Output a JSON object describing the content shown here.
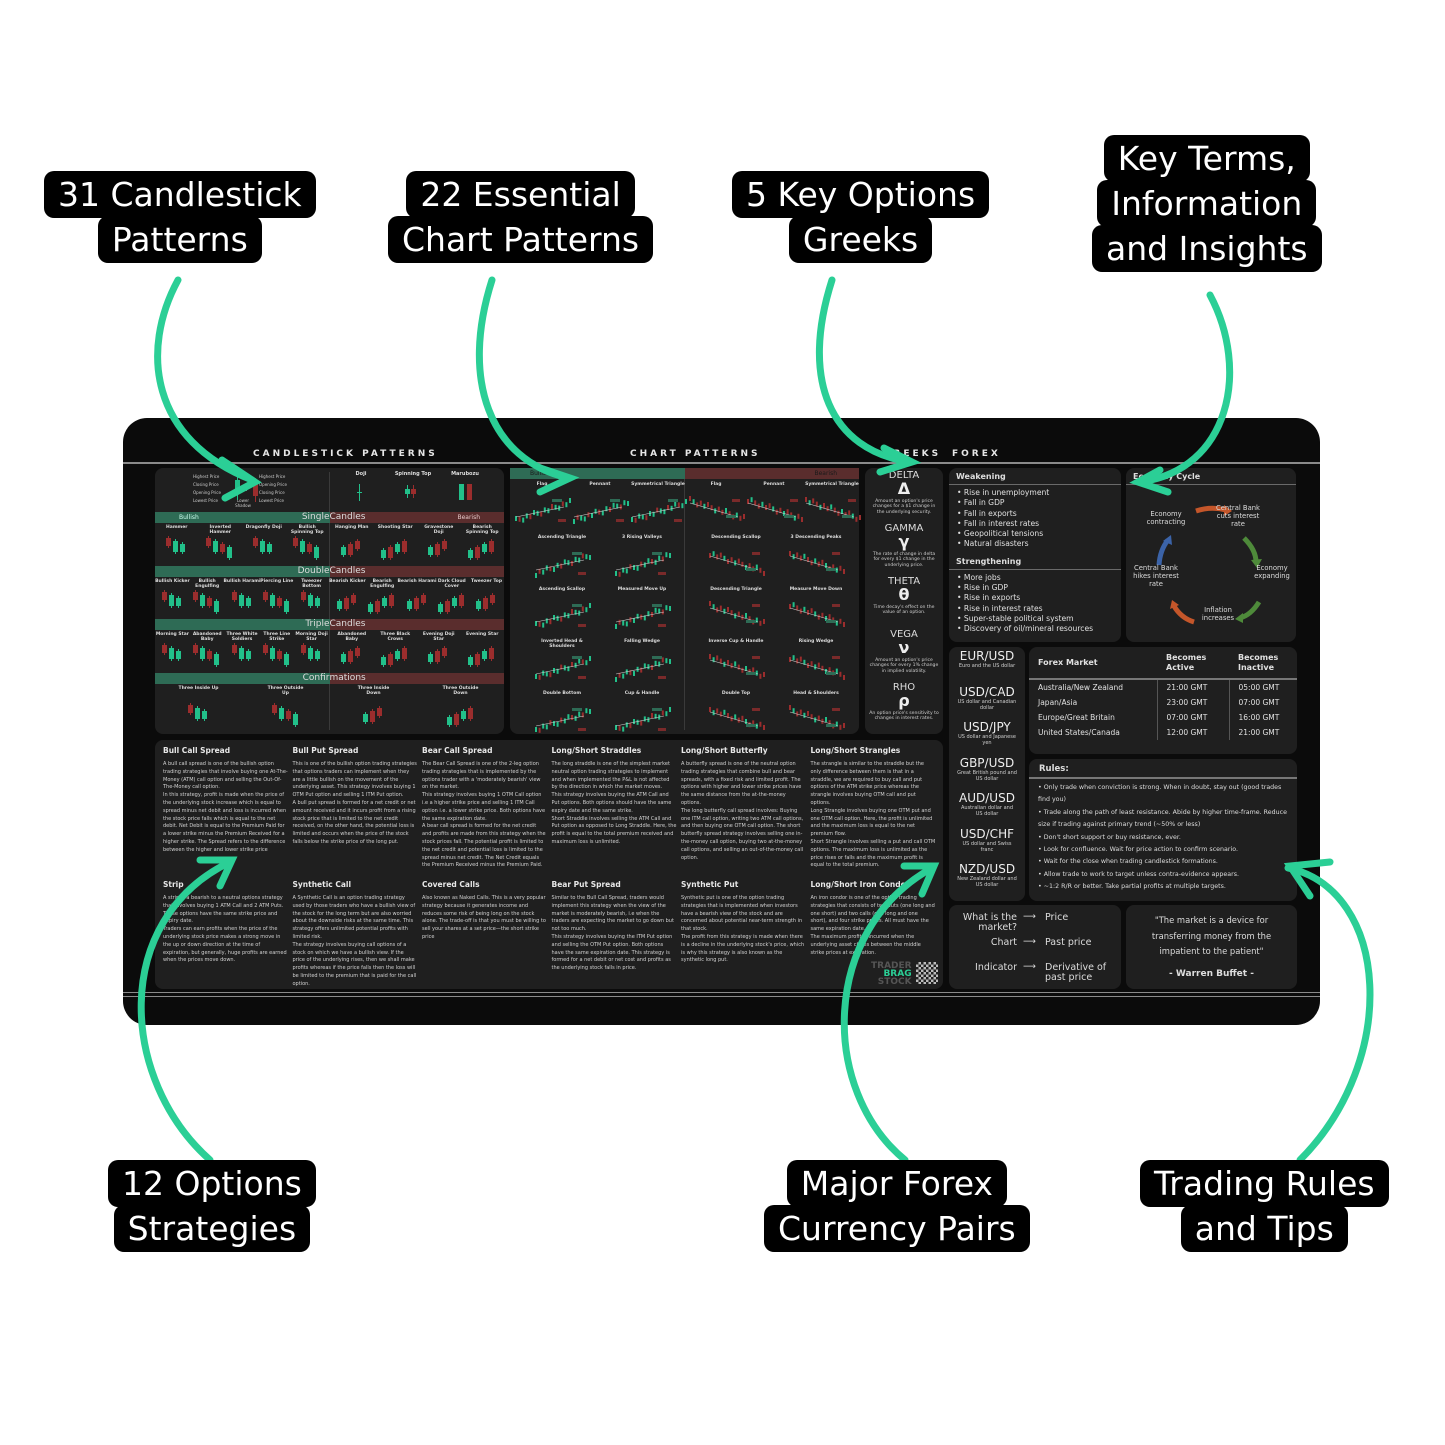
{
  "callouts": [
    {
      "id": "candlestick",
      "lines": [
        "31  Candlestick",
        "Patterns"
      ]
    },
    {
      "id": "chart",
      "lines": [
        "22 Essential",
        "Chart Patterns"
      ]
    },
    {
      "id": "greeks",
      "lines": [
        "5 Key Options",
        "Greeks"
      ]
    },
    {
      "id": "terms",
      "lines": [
        "Key Terms,",
        "Information",
        "and Insights"
      ]
    },
    {
      "id": "options",
      "lines": [
        "12 Options",
        "Strategies"
      ]
    },
    {
      "id": "forex",
      "lines": [
        "Major Forex",
        "Currency Pairs"
      ]
    },
    {
      "id": "rules",
      "lines": [
        "Trading Rules",
        "and Tips"
      ]
    }
  ],
  "colors": {
    "accent": "#2bcf96",
    "bull": "#2e6b55",
    "bear": "#5a2d2d",
    "candle_up": "#22c08a",
    "candle_down": "#9b2d2d",
    "mat": "#0b0b0b",
    "panel": "#1f1f1f"
  },
  "headers": {
    "candlestick": "CANDLESTICK PATTERNS",
    "chart": "CHART PATTERNS",
    "greeks": "GREEKS",
    "forex": "FOREX"
  },
  "candle_anatomy": {
    "labels_left": [
      "Highest Price",
      "Closing Price",
      "Opening Price",
      "Lowest Price"
    ],
    "labels_mid": [
      "Body",
      "Lower Shadow"
    ],
    "labels_right": [
      "Highest Price",
      "Opening Price",
      "Closing Price",
      "Lowest Price"
    ],
    "basic": [
      "Doji",
      "Spinning Top",
      "Marubozu"
    ]
  },
  "candlestick": {
    "side_bull": "Bullish",
    "side_bear": "Bearish",
    "sections": [
      {
        "title_a": "Single",
        "title_b": "Candles",
        "bull": [
          "Hammer",
          "Inverted Hammer",
          "Dragonfly Doji",
          "Bullish Spinning Top"
        ],
        "bear": [
          "Hanging Man",
          "Shooting Star",
          "Gravestone Doji",
          "Bearish Spinning Top"
        ]
      },
      {
        "title_a": "Double",
        "title_b": "Candles",
        "bull": [
          "Bullish Kicker",
          "Bullish Engulfing",
          "Bullish Harami",
          "Piercing Line",
          "Tweezer Bottom"
        ],
        "bear": [
          "Bearish Kicker",
          "Bearish Engulfing",
          "Bearish Harami",
          "Dark Cloud Cover",
          "Tweezer Top"
        ]
      },
      {
        "title_a": "Triple",
        "title_b": "Candles",
        "bull": [
          "Morning Star",
          "Abandoned Baby",
          "Three White Soldiers",
          "Three Line Strike",
          "Morning Doji Star"
        ],
        "bear": [
          "Abandoned Baby",
          "Three Black Crows",
          "Evening Doji Star",
          "Evening Star"
        ]
      },
      {
        "title_a": "Confir",
        "title_b": "mations",
        "bull": [
          "Three Inside Up",
          "Three Outside Up"
        ],
        "bear": [
          "Three Inside Down",
          "Three Outside Down"
        ]
      }
    ]
  },
  "chart_patterns": {
    "side_bull": "Bullish",
    "side_bear": "Bearish",
    "bull": [
      "Flag",
      "Pennant",
      "Symmetrical Triangle",
      "Ascending Triangle",
      "3 Rising Valleys",
      "Ascending Scallop",
      "Measured Move Up",
      "Inverted Head & Shoulders",
      "Falling Wedge",
      "Double Bottom",
      "Cup & Handle"
    ],
    "bear": [
      "Flag",
      "Pennant",
      "Symmetrical Triangle",
      "Descending Scallop",
      "3 Descending Peaks",
      "Descending Triangle",
      "Measure Move Down",
      "Inverse Cup & Handle",
      "Rising Wedge",
      "Double Top",
      "Head & Shoulders"
    ],
    "marker_entry": "ENTRY",
    "marker_stop": "STOP"
  },
  "greeks": [
    {
      "name": "DELTA",
      "symbol": "Δ",
      "desc": "Amount an option's price changes for a $1 change in the underlying security."
    },
    {
      "name": "GAMMA",
      "symbol": "γ",
      "desc": "The rate of change in delta for every $1 change in the underlying price."
    },
    {
      "name": "THETA",
      "symbol": "θ",
      "desc": "Time decay's effect on the value of an option."
    },
    {
      "name": "VEGA",
      "symbol": "ν",
      "desc": "Amount an option's price changes for every 1% change in implied volatility."
    },
    {
      "name": "RHO",
      "symbol": "ρ",
      "desc": "An option price's sensitivity to changes in interest rates."
    }
  ],
  "forex": {
    "weakening": {
      "title": "Weakening",
      "items": [
        "Rise in unemployment",
        "Fall in GDP",
        "Fall in exports",
        "Fall in interest rates",
        "Geopolitical tensions",
        "Natural disasters"
      ]
    },
    "strengthening": {
      "title": "Strengthening",
      "items": [
        "More jobs",
        "Rise in GDP",
        "Rise in exports",
        "Rise in interest rates",
        "Super-stable political system",
        "Discovery of oil/mineral resources"
      ]
    },
    "economy_cycle": {
      "title": "Economy Cycle",
      "steps": [
        "Economy contracting",
        "Central Bank cuts interest rate",
        "Economy expanding",
        "Inflation increases",
        "Central Bank hikes interest rate"
      ]
    },
    "pairs": [
      {
        "code": "EUR/USD",
        "desc": "Euro and the US dollar"
      },
      {
        "code": "USD/CAD",
        "desc": "US dollar and Canadian dollar"
      },
      {
        "code": "USD/JPY",
        "desc": "US dollar and Japanese yen"
      },
      {
        "code": "GBP/USD",
        "desc": "Great British pound and US dollar"
      },
      {
        "code": "AUD/USD",
        "desc": "Australian dollar and US dollar"
      },
      {
        "code": "USD/CHF",
        "desc": "US dollar and Swiss franc"
      },
      {
        "code": "NZD/USD",
        "desc": "New Zealand dollar and US dollar"
      }
    ],
    "market_table": {
      "headers": [
        "Forex Market",
        "Becomes Active",
        "Becomes Inactive"
      ],
      "rows": [
        [
          "Australia/New Zealand",
          "21:00 GMT",
          "05:00 GMT"
        ],
        [
          "Japan/Asia",
          "23:00 GMT",
          "07:00 GMT"
        ],
        [
          "Europe/Great Britain",
          "07:00 GMT",
          "16:00 GMT"
        ],
        [
          "United States/Canada",
          "12:00 GMT",
          "21:00 GMT"
        ]
      ]
    },
    "rules": {
      "title": "Rules:",
      "items": [
        "Only trade when conviction is strong. When in doubt, stay out (good trades find you)",
        "Trade along the path of least resistance. Abide by higher time-frame. Reduce size if trading against primary trend (~50% or less)",
        "Don't short support or buy resistance, ever.",
        "Look for confluence. Wait for price action to confirm scenario.",
        "Wait for the close when trading candlestick formations.",
        "Allow trade to work to target unless contra-evidence appears.",
        "~1:2 R/R or better. Take partial profits at multiple targets."
      ]
    },
    "terms": [
      {
        "term": "What is the market?",
        "meaning": "Price"
      },
      {
        "term": "Chart",
        "meaning": "Past price"
      },
      {
        "term": "Indicator",
        "meaning": "Derivative of past price"
      }
    ],
    "quote": {
      "text": "\"The market is a device for transferring money from the impatient to the patient\"",
      "author": "- Warren Buffet -"
    }
  },
  "strategies": [
    {
      "title": "Bull Call Spread",
      "body": "A bull call spread is one of the bullish option trading strategies that involve buying one At-The-Money (ATM) call option and selling the Out-Of-The-Money call option.\nIn this strategy, profit is made when the price of the underlying stock increase which is equal to spread minus net debit and loss is incurred when the stock price falls which is equal to the net debit. Net Debit is equal to the Premium Paid for a lower strike minus the Premium Received for a higher strike. The Spread refers to the difference between the higher and lower strike price"
    },
    {
      "title": "Bull Put Spread",
      "body": "This is one of the bullish option trading strategies that options traders can implement when they are a little bullish on the movement of the underlying asset. This strategy involves buying 1 OTM Put option and selling 1 ITM Put option.\nA bull put spread is formed for a net credit or net amount received and it incurs profit from a rising stock price that is limited to the net credit received, on the other hand, the potential loss is limited and occurs when the price of the stock falls below the strike price of the long put."
    },
    {
      "title": "Bear Call Spread",
      "body": "The Bear Call Spread is one of the 2-leg option trading strategies that is implemented by the options trader with a 'moderately bearish' view on the market.\nThis strategy involves buying 1 OTM Call option i.e a higher strike price and selling 1 ITM Call option i.e. a lower strike price. Both options have the same expiration date.\nA bear call spread is formed for the net credit and profits are made from this strategy when the stock prices fall. The potential profit is limited to the net credit and potential loss is limited to the spread minus net credit. The Net Credit equals the Premium Received minus the Premium Paid."
    },
    {
      "title": "Long/Short Straddles",
      "body": "The long straddle is one of the simplest market neutral option trading strategies to implement and when implemented the P&L is not affected by the direction in which the market moves.\nThis strategy involves buying the ATM Call and Put options. Both options should have the same expiry date and the same strike.\nShort Straddle involves selling the ATM Call and Put option as opposed to Long Straddle. Here, the profit is equal to the total premium received and maximum loss is unlimited."
    },
    {
      "title": "Long/Short Butterfly",
      "body": "A butterfly spread is one of the neutral option trading strategies that combine bull and bear spreads, with a fixed risk and limited profit. The options with higher and lower strike prices have the same distance from the at-the-money options.\nThe long butterfly call spread involves: Buying one ITM call option, writing two ATM call options, and then buying one OTM call option. The short butterfly spread strategy involves selling one in-the-money call option, buying two at-the-money call options, and selling an out-of-the-money call option."
    },
    {
      "title": "Long/Short Strangles",
      "body": "The strangle is similar to the straddle but the only difference between them is that in a straddle, we are required to buy call and put options of the ATM strike price whereas the strangle involves buying OTM call and put options.\nLong Strangle involves buying one OTM put and one OTM call option. Here, the profit is unlimited and the maximum loss is equal to the net premium flow.\nShort Strangle involves selling a put and call OTM options. The maximum loss is unlimited as the price rises or falls and the maximum profit is equal to the total premium."
    },
    {
      "title": "Strip",
      "body": "A strip is a bearish to a neutral options strategy that involves buying 1 ATM Call and 2 ATM Puts.\nThese options have the same strike price and expiry date.\nTraders can earn profits when the price of the underlying stock price makes a strong move in the up or down direction at the time of expiration, but generally, huge profits are earned when the prices move down."
    },
    {
      "title": "Synthetic Call",
      "body": "A Synthetic Call is an option trading strategy used by those traders who have a bullish view of the stock for the long term but are also worried about the downside risks at the same time. This strategy offers unlimited potential profits with limited risk.\nThe strategy involves buying call options of a stock on which we have a bullish view. If the price of the underlying rises, then we shall make profits whereas if the price falls then the loss will be limited to the premium that is paid for the call option."
    },
    {
      "title": "Covered Calls",
      "body": "Also known as Naked Calls. This is a very popular strategy because it generates income and reduces some risk of being long on the stock alone. The trade-off is that you must be willing to sell your shares at a set price—the short strike price"
    },
    {
      "title": "Bear Put Spread",
      "body": "Similar to the Bull Call Spread, traders would implement this strategy when the view of the market is moderately bearish, i.e when the traders are expecting the market to go down but not too much.\nThis strategy involves buying the ITM Put option and selling the OTM Put option. Both options have the same expiration date. This strategy is formed for a net debit or net cost and profits as the underlying stock falls in price."
    },
    {
      "title": "Synthetic Put",
      "body": "Synthetic put is one of the option trading strategies that is implemented when investors have a bearish view of the stock and are concerned about potential near-term strength in that stock.\nThe profit from this strategy is made when there is a decline in the underlying stock's price, which is why this strategy is also known as the synthetic long put."
    },
    {
      "title": "Long/Short Iron Condor",
      "body": "An iron condor is one of the option trading strategies that consists of two puts (one long and one short) and two calls (one long and one short), and four strike prices. All must have the same expiration date.\nThe maximum profit is incurred when the underlying asset closes between the middle strike prices at expiration."
    }
  ],
  "brand": {
    "line1": "TRADER",
    "line2": "BRAG",
    "line3": "STOCK"
  }
}
